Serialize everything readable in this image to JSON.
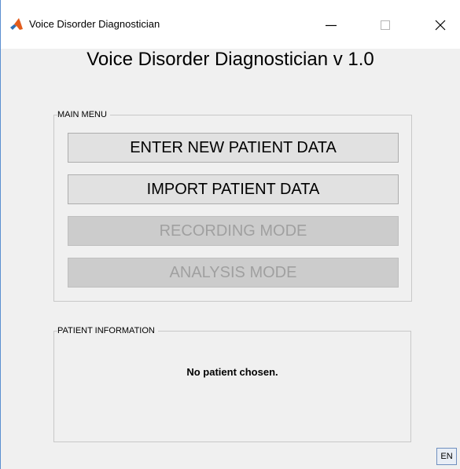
{
  "window": {
    "title": "Voice Disorder Diagnostician",
    "controls": {
      "minimize": "minimize-icon",
      "maximize": "maximize-icon",
      "close": "close-icon"
    }
  },
  "header": {
    "title": "Voice Disorder Diagnostician v 1.0"
  },
  "main_menu": {
    "legend": "MAIN MENU",
    "buttons": [
      {
        "label": "ENTER NEW PATIENT DATA",
        "enabled": true
      },
      {
        "label": "IMPORT PATIENT DATA",
        "enabled": true
      },
      {
        "label": "RECORDING MODE",
        "enabled": false
      },
      {
        "label": "ANALYSIS MODE",
        "enabled": false
      }
    ]
  },
  "patient_info": {
    "legend": "PATIENT INFORMATION",
    "status": "No patient chosen."
  },
  "taskbar": {
    "language": "EN"
  },
  "colors": {
    "window_bg": "#f0f0f0",
    "button_bg": "#e1e1e1",
    "disabled_text": "#a0a0a0"
  }
}
